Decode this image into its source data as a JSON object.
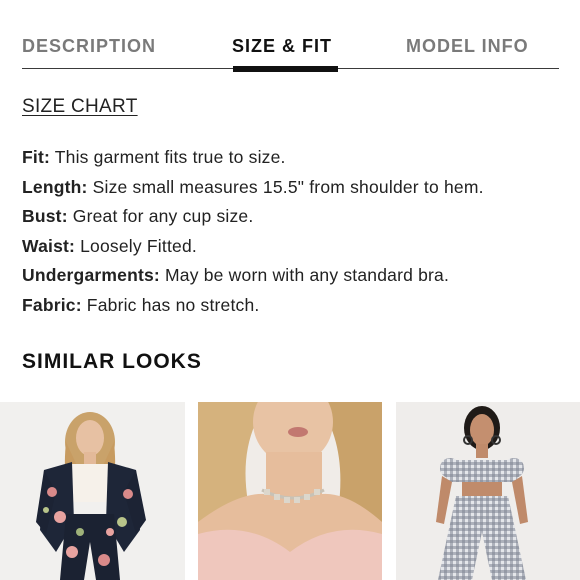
{
  "tabs": {
    "description": "DESCRIPTION",
    "size_fit": "SIZE & FIT",
    "model_info": "MODEL INFO",
    "active": "size_fit"
  },
  "size_chart_link": "SIZE CHART",
  "details": [
    {
      "label": "Fit:",
      "value": " This garment fits true to size."
    },
    {
      "label": "Length:",
      "value": " Size small measures 15.5\" from shoulder to hem."
    },
    {
      "label": "Bust:",
      "value": " Great for any cup size."
    },
    {
      "label": "Waist:",
      "value": " Loosely Fitted."
    },
    {
      "label": "Undergarments:",
      "value": " May be worn with any standard bra."
    },
    {
      "label": "Fabric:",
      "value": " Fabric has no stretch."
    }
  ],
  "similar_looks": {
    "heading": "SIMILAR LOOKS",
    "items": [
      {
        "name": "floral-suit-look-image"
      },
      {
        "name": "choker-necklace-look-image"
      },
      {
        "name": "gingham-set-look-image"
      }
    ]
  },
  "colors": {
    "text": "#222222",
    "inactive_tab": "#7a7a7a",
    "indicator": "#111111"
  }
}
